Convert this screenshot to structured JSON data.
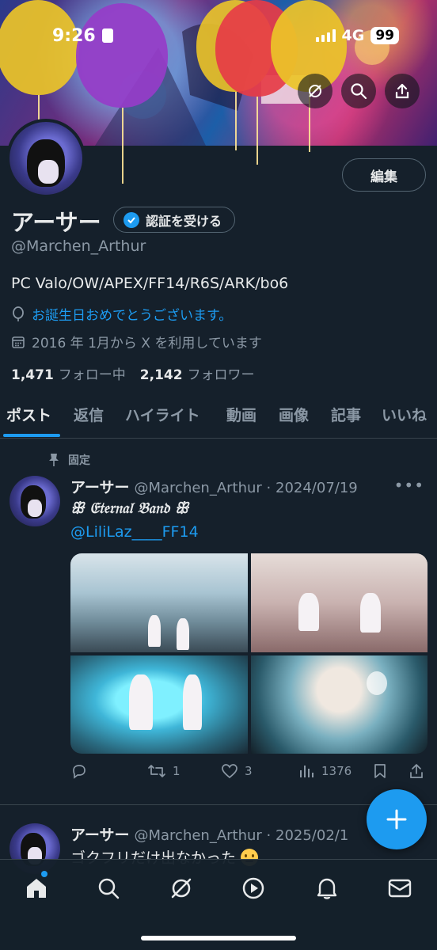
{
  "status_bar": {
    "time": "9:26",
    "network": "4G",
    "battery": "99"
  },
  "profile": {
    "edit_label": "編集",
    "display_name": "アーサー",
    "verify_label": "認証を受ける",
    "handle": "@Marchen_Arthur",
    "bio": "PC Valo/OW/APEX/FF14/R6S/ARK/bo6",
    "birthday_text": "お誕生日おめでとうございます。",
    "joined_text": "2016 年 1月から X を利用しています",
    "following_count": "1,471",
    "following_label": "フォロー中",
    "followers_count": "2,142",
    "followers_label": "フォロワー"
  },
  "tabs": [
    "ポスト",
    "返信",
    "ハイライト",
    "動画",
    "画像",
    "記事",
    "いいね"
  ],
  "pinned_label": "固定",
  "tweets": [
    {
      "name": "アーサー",
      "meta": "@Marchen_Arthur · 2024/07/19",
      "text": "ꕥ 𝔈𝔱𝔢𝔯𝔫𝔞𝔩 𝔅𝔞𝔫𝔡 ꕥ",
      "mention": "@LiliLaz____FF14",
      "replies": "",
      "retweets": "1",
      "likes": "3",
      "views": "1376"
    },
    {
      "name": "アーサー",
      "meta": "@Marchen_Arthur · 2025/02/1",
      "text": "ゴクフリだけ出なかった"
    }
  ],
  "icons": {
    "home": "home-icon",
    "search": "search-icon",
    "grok": "grok-icon",
    "video": "play-icon",
    "notifications": "bell-icon",
    "messages": "mail-icon"
  },
  "colors": {
    "accent": "#1d9bf0",
    "background": "#15202b",
    "muted": "#8b98a5"
  }
}
